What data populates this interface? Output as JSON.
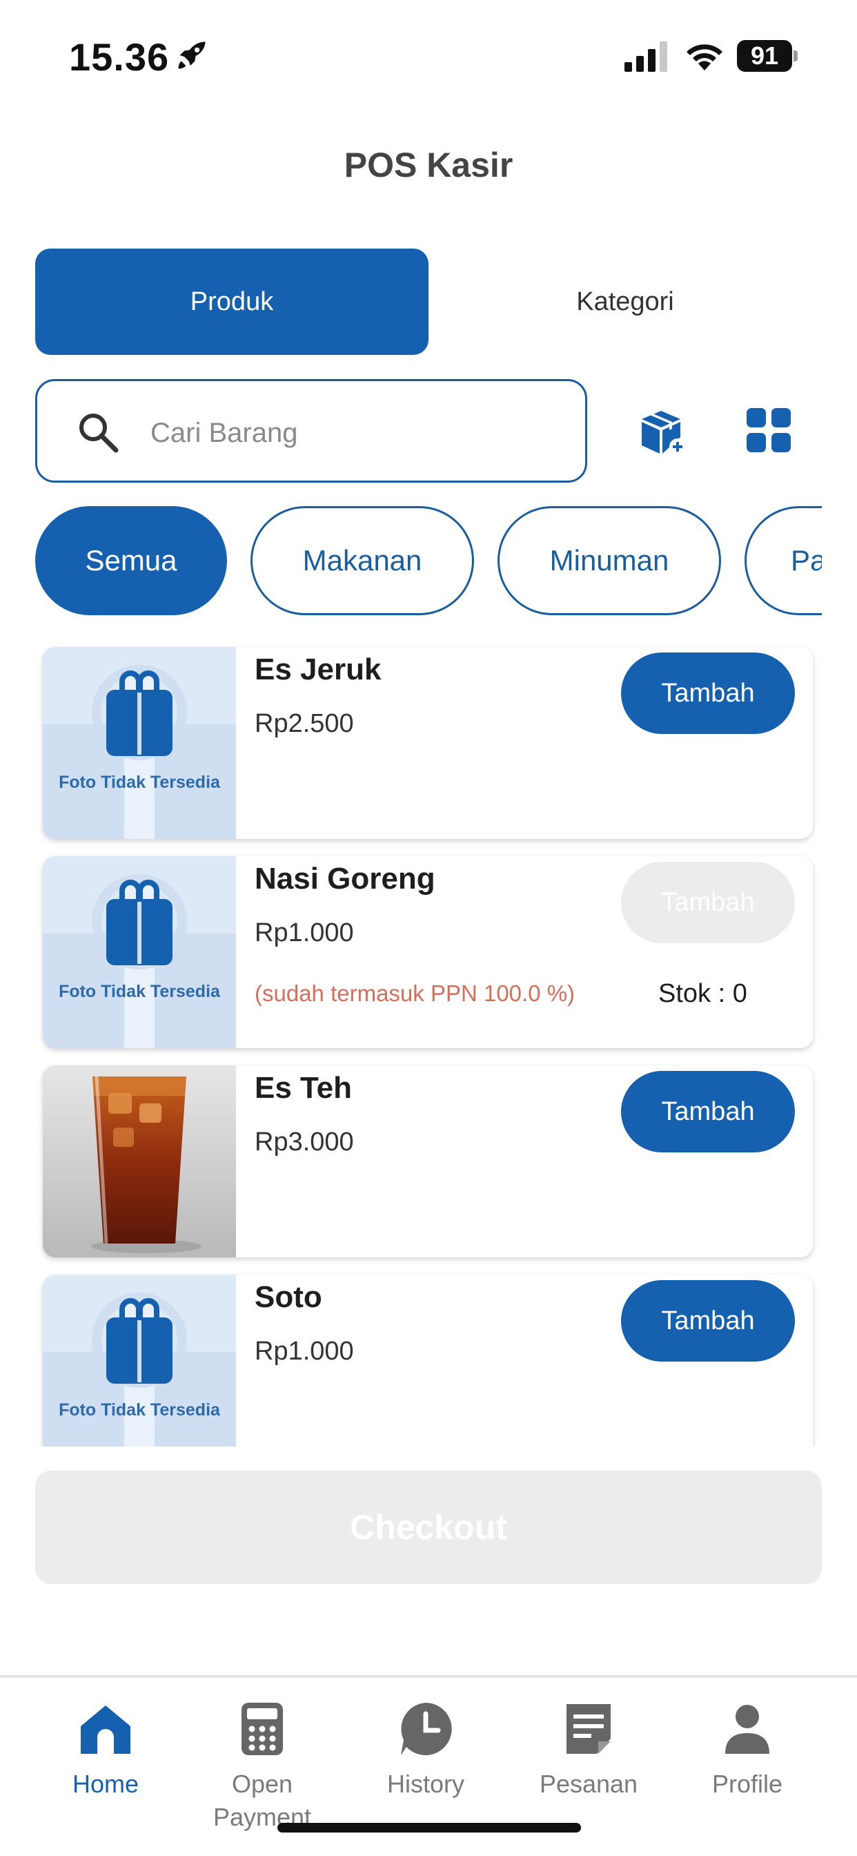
{
  "status_bar": {
    "time": "15.36",
    "battery": "91"
  },
  "header": {
    "title": "POS Kasir"
  },
  "tabs": [
    {
      "label": "Produk",
      "active": true
    },
    {
      "label": "Kategori",
      "active": false
    }
  ],
  "search": {
    "placeholder": "Cari Barang",
    "value": ""
  },
  "toolbar_icons": [
    "add-product-icon",
    "grid-view-icon"
  ],
  "categories": [
    {
      "label": "Semua",
      "active": true
    },
    {
      "label": "Makanan",
      "active": false
    },
    {
      "label": "Minuman",
      "active": false
    },
    {
      "label": "Pa",
      "active": false
    }
  ],
  "products": [
    {
      "name": "Es Jeruk",
      "price": "Rp2.500",
      "image": "placeholder",
      "image_text": "Foto Tidak Tersedia",
      "button": "Tambah",
      "enabled": true
    },
    {
      "name": "Nasi Goreng",
      "price": "Rp1.000",
      "image": "placeholder",
      "image_text": "Foto Tidak Tersedia",
      "tax_note": "(sudah termasuk PPN 100.0 %)",
      "stock": "Stok : 0",
      "button": "Tambah",
      "enabled": false
    },
    {
      "name": "Es Teh",
      "price": "Rp3.000",
      "image": "iced-tea-photo",
      "button": "Tambah",
      "enabled": true
    },
    {
      "name": "Soto",
      "price": "Rp1.000",
      "image": "placeholder",
      "image_text": "Foto Tidak Tersedia",
      "button": "Tambah",
      "enabled": true
    }
  ],
  "checkout": {
    "label": "Checkout",
    "enabled": false
  },
  "bottom_nav": [
    {
      "label": "Home",
      "icon": "home-icon",
      "active": true
    },
    {
      "label": "Open\nPayment",
      "icon": "calculator-icon",
      "active": false
    },
    {
      "label": "History",
      "icon": "history-icon",
      "active": false
    },
    {
      "label": "Pesanan",
      "icon": "order-icon",
      "active": false
    },
    {
      "label": "Profile",
      "icon": "profile-icon",
      "active": false
    }
  ],
  "colors": {
    "primary": "#1561b0",
    "disabled": "#ececec",
    "tax_note": "#d36f5b",
    "placeholder_bg": "#dde9f7"
  }
}
